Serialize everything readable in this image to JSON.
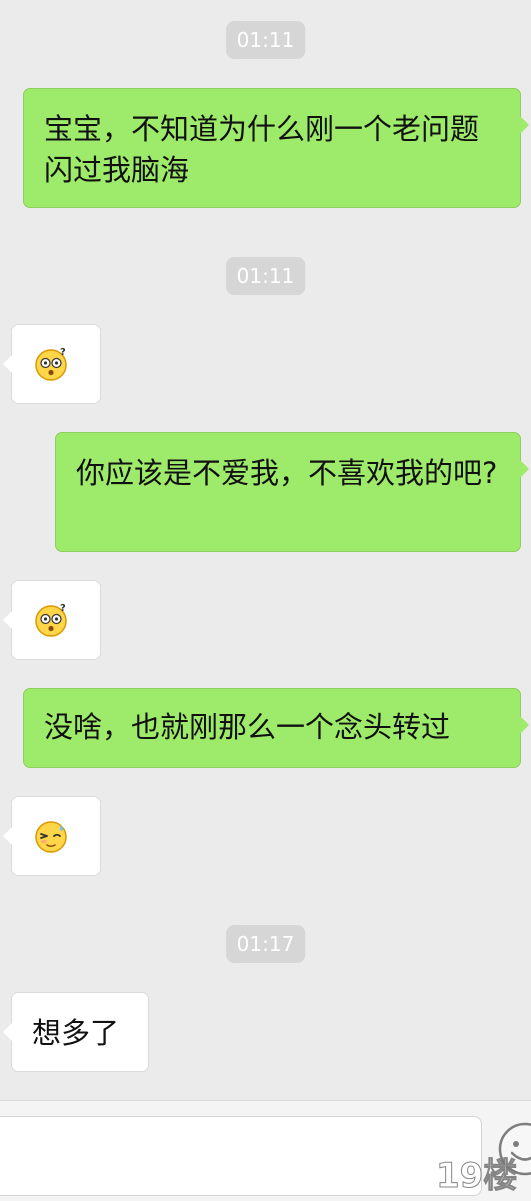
{
  "chat": {
    "timestamps": [
      "01:11",
      "01:11",
      "01:17"
    ],
    "messages": {
      "m1": "宝宝，不知道为什么刚一个老问题闪过我脑海",
      "m2_emoji": "dizzy-confused-emoji",
      "m3": "你应该是不爱我，不喜欢我的吧?",
      "m4_emoji": "dizzy-confused-emoji",
      "m5": "没啥，也就刚那么一个念头转过",
      "m6_emoji": "embarrassed-sweat-emoji",
      "m7": "想多了"
    }
  },
  "input_bar": {
    "message_input_value": "",
    "emoji_button_icon": "smiley-face-icon"
  },
  "watermark": {
    "text": "19楼"
  },
  "colors": {
    "background": "#ebebeb",
    "sent_bubble": "#9eea6a",
    "received_bubble": "#ffffff",
    "timestamp_bg": "#d6d6d6"
  }
}
